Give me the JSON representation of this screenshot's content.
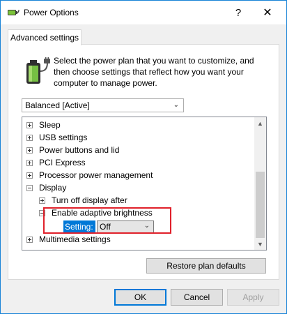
{
  "window": {
    "title": "Power Options",
    "help_glyph": "?",
    "close_glyph": "✕"
  },
  "tab": {
    "label": "Advanced settings"
  },
  "intro": "Select the power plan that you want to customize, and then choose settings that reflect how you want your computer to manage power.",
  "plan": {
    "selected": "Balanced [Active]"
  },
  "tree": {
    "items": [
      {
        "label": "Sleep",
        "expander": "plus"
      },
      {
        "label": "USB settings",
        "expander": "plus"
      },
      {
        "label": "Power buttons and lid",
        "expander": "plus"
      },
      {
        "label": "PCI Express",
        "expander": "plus"
      },
      {
        "label": "Processor power management",
        "expander": "plus"
      },
      {
        "label": "Display",
        "expander": "minus"
      },
      {
        "label": "Turn off display after",
        "expander": "plus"
      },
      {
        "label": "Enable adaptive brightness",
        "expander": "minus"
      },
      {
        "label": "Multimedia settings",
        "expander": "plus"
      }
    ],
    "setting": {
      "label": "Setting:",
      "value": "Off"
    }
  },
  "buttons": {
    "restore": "Restore plan defaults",
    "ok": "OK",
    "cancel": "Cancel",
    "apply": "Apply"
  },
  "colors": {
    "accent": "#0078d7",
    "highlight_box": "#e0202a",
    "window_border": "#1883d7"
  },
  "icons": {
    "title": "power-plug-icon",
    "panel": "battery-plug-icon"
  }
}
